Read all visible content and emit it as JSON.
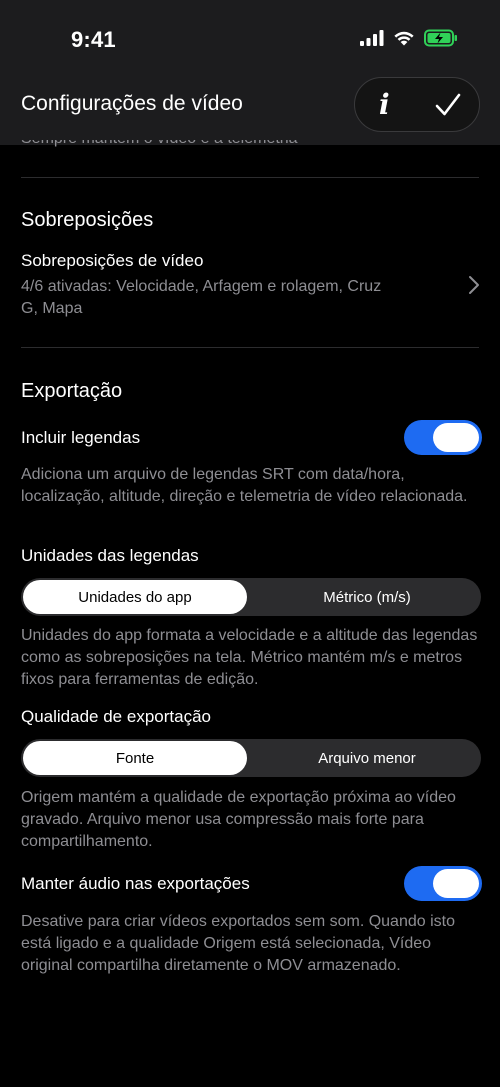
{
  "status_bar": {
    "time": "9:41",
    "icons": [
      "signal-icon",
      "wifi-icon",
      "battery-charging-icon"
    ],
    "battery_color": "#30d158"
  },
  "nav": {
    "title": "Configurações de vídeo",
    "info_label": "i",
    "icons": [
      "info-icon",
      "checkmark-icon"
    ]
  },
  "peek_text": "Sempre mantém o vídeo e a telemetria sincronizados",
  "overlays": {
    "section_title": "Sobreposições",
    "row_title": "Sobreposições de vídeo",
    "row_detail": "4/6 ativadas: Velocidade, Arfagem e rolagem, Cruz G, Mapa"
  },
  "export": {
    "section_title": "Exportação",
    "include_subtitles": {
      "label": "Incluir legendas",
      "on": true,
      "description": "Adiciona um arquivo de legendas SRT com data/hora, localização, altitude, direção e telemetria de vídeo relacionada."
    },
    "subtitle_units": {
      "label": "Unidades das legendas",
      "options": [
        "Unidades do app",
        "Métrico (m/s)"
      ],
      "selected": "Unidades do app",
      "description": "Unidades do app formata a velocidade e a altitude das legendas como as sobreposições na tela. Métrico mantém m/s e metros fixos para ferramentas de edição."
    },
    "export_quality": {
      "label": "Qualidade de exportação",
      "options": [
        "Fonte",
        "Arquivo menor"
      ],
      "selected": "Fonte",
      "description": "Origem mantém a qualidade de exportação próxima ao vídeo gravado. Arquivo menor usa compressão mais forte para compartilhamento."
    },
    "keep_audio": {
      "label": "Manter áudio nas exportações",
      "on": true,
      "description": "Desative para criar vídeos exportados sem som. Quando isto está ligado e a qualidade Origem está selecionada, Vídeo original compartilha diretamente o MOV armazenado."
    }
  },
  "colors": {
    "accent": "#1e6bf2",
    "background": "#000000",
    "secondary_text": "#8e8e93"
  }
}
